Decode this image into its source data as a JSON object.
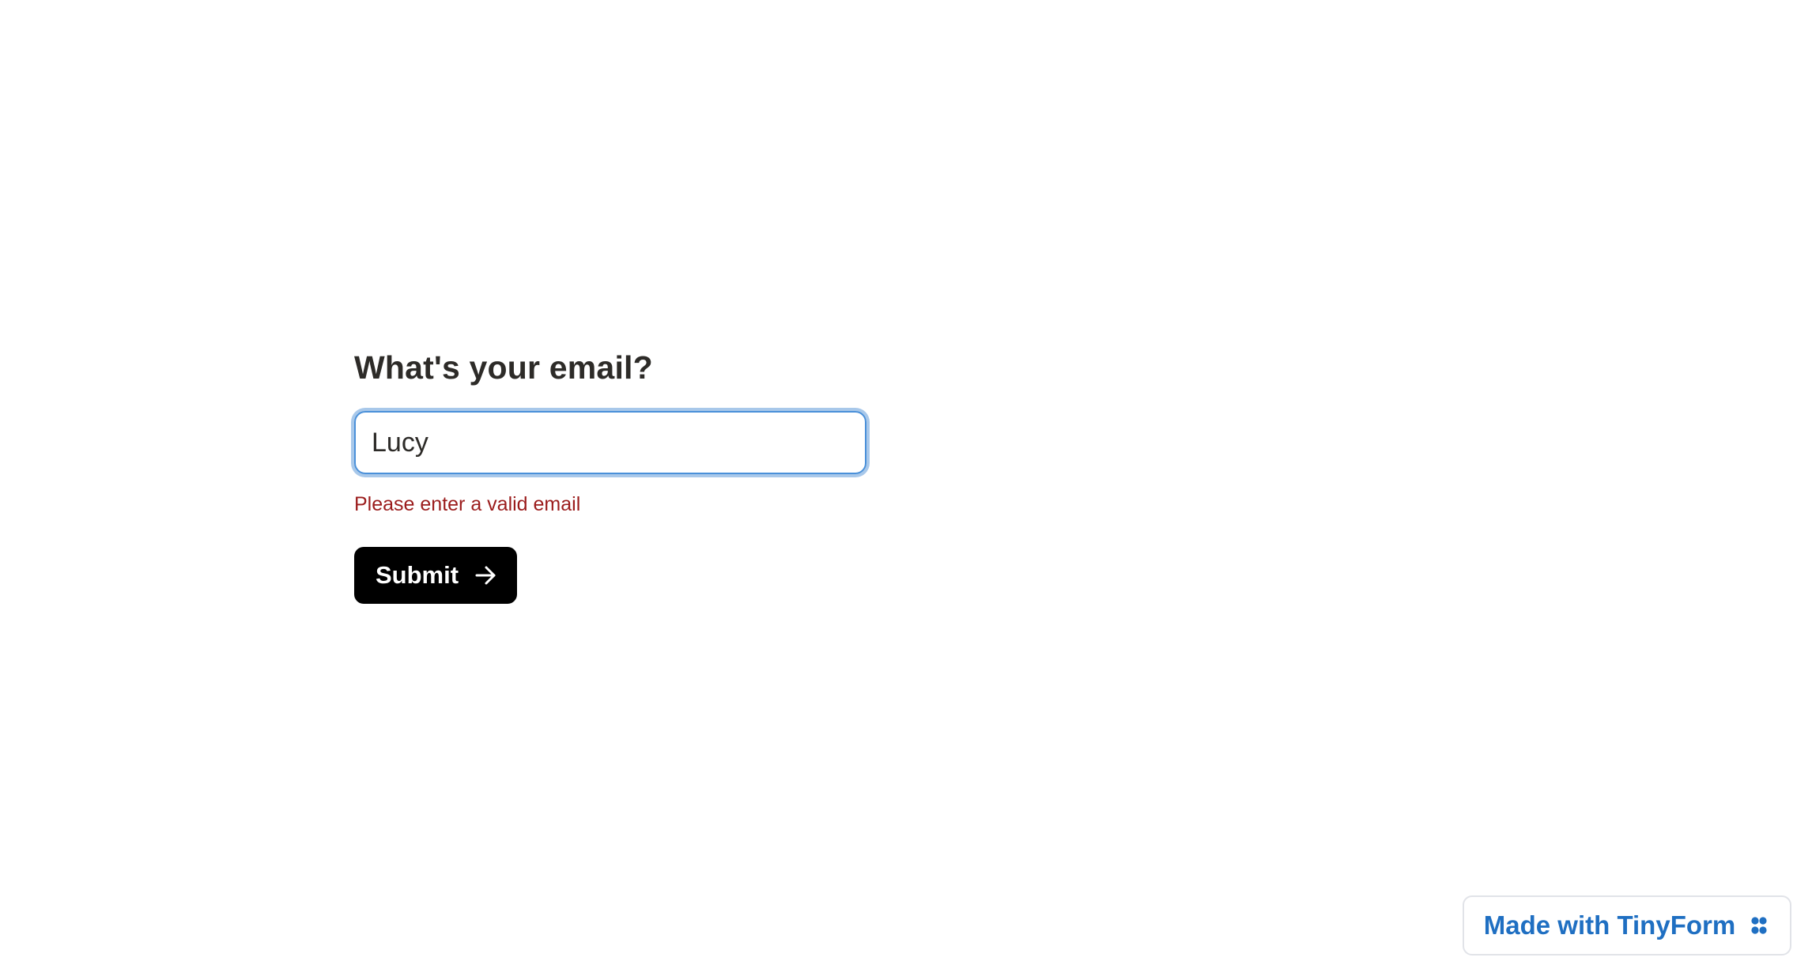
{
  "form": {
    "question": "What's your email?",
    "email_value": "Lucy",
    "error_message": "Please enter a valid email",
    "submit_label": "Submit"
  },
  "icons": {
    "submit": "arrow-right-icon",
    "badge": "tinyform-logo-icon"
  },
  "badge": {
    "label": "Made with TinyForm"
  },
  "colors": {
    "error": "#9b1c1c",
    "focus_ring": "#a8c8ea",
    "button_bg": "#000000",
    "badge_text": "#1f6fc2"
  }
}
